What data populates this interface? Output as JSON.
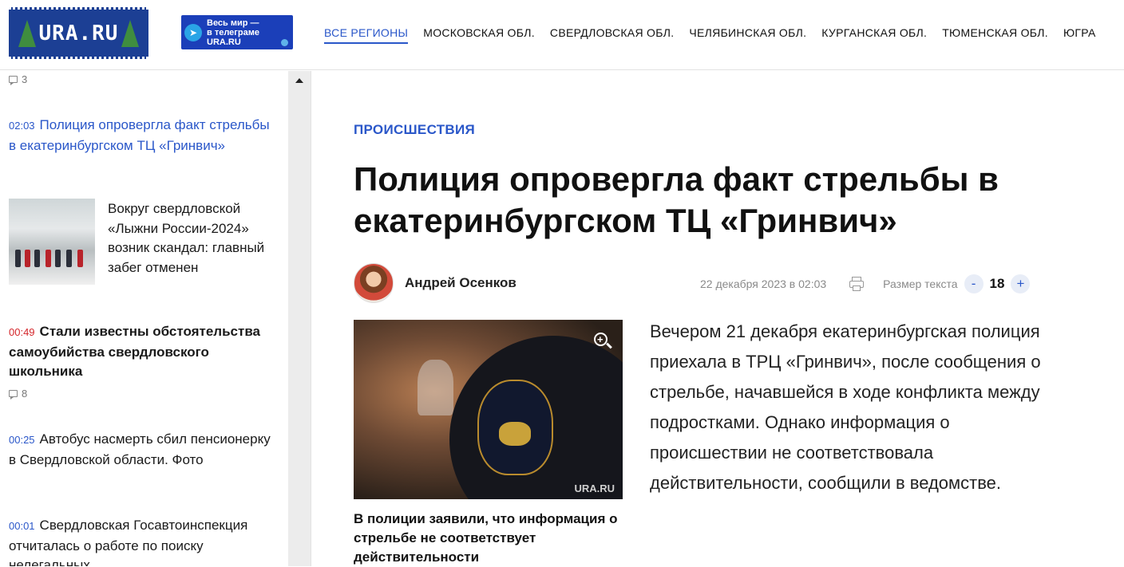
{
  "header": {
    "logo_text": "URA.RU",
    "telegram_banner": {
      "line1": "Весь мир —",
      "line2": "в телеграме",
      "line3": "URA.RU"
    },
    "nav": [
      {
        "label": "ВСЕ РЕГИОНЫ",
        "active": true
      },
      {
        "label": "МОСКОВСКАЯ ОБЛ."
      },
      {
        "label": "СВЕРДЛОВСКАЯ ОБЛ."
      },
      {
        "label": "ЧЕЛЯБИНСКАЯ ОБЛ."
      },
      {
        "label": "КУРГАНСКАЯ ОБЛ."
      },
      {
        "label": "ТЮМЕНСКАЯ ОБЛ."
      },
      {
        "label": "ЮГРА"
      }
    ]
  },
  "sidebar": {
    "top_comments": "3",
    "items": [
      {
        "time": "02:03",
        "title": "Полиция опровергла факт стрельбы в екатеринбургском ТЦ «Гринвич»"
      },
      {
        "time": "",
        "title": "Вокруг свердловской «Лыжни России-2024» возник скандал: главный забег отменен"
      },
      {
        "time": "00:49",
        "title": "Стали известны обстоятельства самоубийства свердловского школьника",
        "comments": "8"
      },
      {
        "time": "00:25",
        "title": "Автобус насмерть сбил пенсионерку в Свердловской области. Фото"
      },
      {
        "time": "00:01",
        "title": "Свердловская Госавтоинспекция отчиталась о работе по поиску нелегальных"
      }
    ]
  },
  "article": {
    "rubric": "ПРОИСШЕСТВИЯ",
    "headline": "Полиция опровергла факт стрельбы в екатеринбургском ТЦ «Гринвич»",
    "author": "Андрей Осенков",
    "date": "22 декабря 2023 в 02:03",
    "text_size_label": "Размер текста",
    "text_size_minus": "-",
    "text_size_value": "18",
    "text_size_plus": "+",
    "photo_watermark": "URA.RU",
    "photo_caption": "В полиции заявили, что информация о стрельбе не соответствует действительности",
    "lead": "Вечером 21 декабря екатеринбургская полиция приехала в ТРЦ «Гринвич», после сообщения о стрельбе, начавшейся в ходе конфликта между подростками. Однако информация о происшествии не соответствовала действительности, сообщили в ведомстве."
  }
}
